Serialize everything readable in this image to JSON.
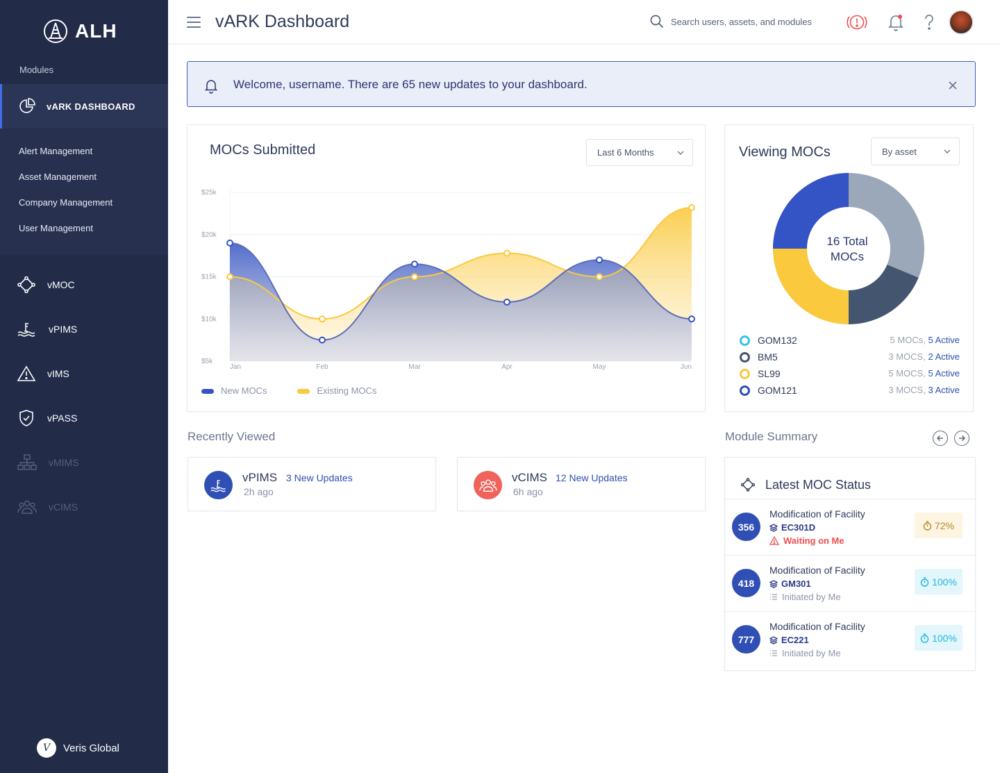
{
  "sidebar": {
    "logo_text": "ALH",
    "modules_label": "Modules",
    "active_item": "vARK DASHBOARD",
    "submenu": [
      "Alert Management",
      "Asset Management",
      "Company Management",
      "User Management"
    ],
    "nav": [
      "vMOC",
      "vPIMS",
      "vIMS",
      "vPASS",
      "vMIMS",
      "vCIMS"
    ],
    "footer": "Veris Global"
  },
  "header": {
    "title": "vARK Dashboard",
    "search_placeholder": "Search users, assets, and modules"
  },
  "banner": {
    "message": "Welcome, username. There are 65 new updates to your dashboard."
  },
  "mocs_submitted": {
    "title": "MOCs Submitted",
    "range_select": "Last 6 Months",
    "legend": [
      "New MOCs",
      "Existing MOCs"
    ]
  },
  "chart_data": {
    "type": "area",
    "categories": [
      "Jan",
      "Feb",
      "Mar",
      "Apr",
      "May",
      "Jun"
    ],
    "yticks": [
      "$25k",
      "$20k",
      "$15k",
      "$10k",
      "$5k"
    ],
    "ylim": [
      5000,
      25000
    ],
    "series": [
      {
        "name": "New MOCs",
        "values": [
          19000,
          7500,
          16500,
          12000,
          17000,
          10000
        ],
        "color": "#3453c4"
      },
      {
        "name": "Existing MOCs",
        "values": [
          15000,
          10000,
          15000,
          17800,
          15000,
          23200
        ],
        "color": "#fbc93d"
      }
    ],
    "grid": true,
    "legend_position": "bottom-left"
  },
  "viewing_mocs": {
    "title": "Viewing MOCs",
    "select": "By asset",
    "center_line1": "16 Total",
    "center_line2": "MOCs",
    "donut": [
      {
        "label": "gray",
        "value": 5,
        "color": "#9aa8ba"
      },
      {
        "label": "dark",
        "value": 3,
        "color": "#445570"
      },
      {
        "label": "yellow",
        "value": 4,
        "color": "#fbc93d"
      },
      {
        "label": "blue",
        "value": 4,
        "color": "#3453c4"
      }
    ],
    "legend": [
      {
        "name": "GOM132",
        "count": "5 MOCs,",
        "active": "5 Active",
        "color": "#35c4eb"
      },
      {
        "name": "BM5",
        "count": "3 MOCS,",
        "active": "2 Active",
        "color": "#445570"
      },
      {
        "name": "SL99",
        "count": "5 MOCS,",
        "active": "5 Active",
        "color": "#fbc93d"
      },
      {
        "name": "GOM121",
        "count": "3 MOCS,",
        "active": "3 Active",
        "color": "#2f4fb5"
      }
    ]
  },
  "recently_viewed": {
    "title": "Recently Viewed",
    "items": [
      {
        "name": "vPIMS",
        "updates": "3 New Updates",
        "time": "2h ago"
      },
      {
        "name": "vCIMS",
        "updates": "12 New Updates",
        "time": "6h ago"
      }
    ]
  },
  "module_summary": {
    "title": "Module Summary",
    "card_title": "Latest MOC Status",
    "rows": [
      {
        "num": "356",
        "title": "Modification of Facility",
        "code": "EC301D",
        "status": "Waiting on Me",
        "pct": "72%"
      },
      {
        "num": "418",
        "title": "Modification of Facility",
        "code": "GM301",
        "status": "Initiated by Me",
        "pct": "100%"
      },
      {
        "num": "777",
        "title": "Modification of Facility",
        "code": "EC221",
        "status": "Initiated by Me",
        "pct": "100%"
      }
    ]
  }
}
